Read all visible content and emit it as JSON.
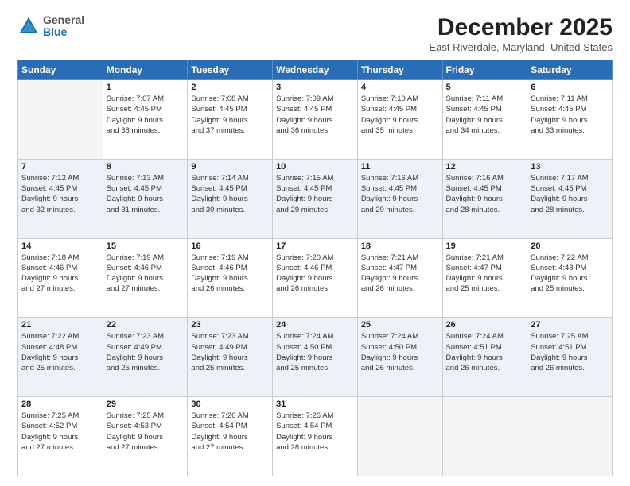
{
  "header": {
    "logo": {
      "line1": "General",
      "line2": "Blue"
    },
    "title": "December 2025",
    "location": "East Riverdale, Maryland, United States"
  },
  "columns": [
    "Sunday",
    "Monday",
    "Tuesday",
    "Wednesday",
    "Thursday",
    "Friday",
    "Saturday"
  ],
  "weeks": [
    [
      {
        "day": "",
        "info": ""
      },
      {
        "day": "1",
        "info": "Sunrise: 7:07 AM\nSunset: 4:45 PM\nDaylight: 9 hours\nand 38 minutes."
      },
      {
        "day": "2",
        "info": "Sunrise: 7:08 AM\nSunset: 4:45 PM\nDaylight: 9 hours\nand 37 minutes."
      },
      {
        "day": "3",
        "info": "Sunrise: 7:09 AM\nSunset: 4:45 PM\nDaylight: 9 hours\nand 36 minutes."
      },
      {
        "day": "4",
        "info": "Sunrise: 7:10 AM\nSunset: 4:45 PM\nDaylight: 9 hours\nand 35 minutes."
      },
      {
        "day": "5",
        "info": "Sunrise: 7:11 AM\nSunset: 4:45 PM\nDaylight: 9 hours\nand 34 minutes."
      },
      {
        "day": "6",
        "info": "Sunrise: 7:11 AM\nSunset: 4:45 PM\nDaylight: 9 hours\nand 33 minutes."
      }
    ],
    [
      {
        "day": "7",
        "info": "Sunrise: 7:12 AM\nSunset: 4:45 PM\nDaylight: 9 hours\nand 32 minutes."
      },
      {
        "day": "8",
        "info": "Sunrise: 7:13 AM\nSunset: 4:45 PM\nDaylight: 9 hours\nand 31 minutes."
      },
      {
        "day": "9",
        "info": "Sunrise: 7:14 AM\nSunset: 4:45 PM\nDaylight: 9 hours\nand 30 minutes."
      },
      {
        "day": "10",
        "info": "Sunrise: 7:15 AM\nSunset: 4:45 PM\nDaylight: 9 hours\nand 29 minutes."
      },
      {
        "day": "11",
        "info": "Sunrise: 7:16 AM\nSunset: 4:45 PM\nDaylight: 9 hours\nand 29 minutes."
      },
      {
        "day": "12",
        "info": "Sunrise: 7:16 AM\nSunset: 4:45 PM\nDaylight: 9 hours\nand 28 minutes."
      },
      {
        "day": "13",
        "info": "Sunrise: 7:17 AM\nSunset: 4:45 PM\nDaylight: 9 hours\nand 28 minutes."
      }
    ],
    [
      {
        "day": "14",
        "info": "Sunrise: 7:18 AM\nSunset: 4:46 PM\nDaylight: 9 hours\nand 27 minutes."
      },
      {
        "day": "15",
        "info": "Sunrise: 7:19 AM\nSunset: 4:46 PM\nDaylight: 9 hours\nand 27 minutes."
      },
      {
        "day": "16",
        "info": "Sunrise: 7:19 AM\nSunset: 4:46 PM\nDaylight: 9 hours\nand 26 minutes."
      },
      {
        "day": "17",
        "info": "Sunrise: 7:20 AM\nSunset: 4:46 PM\nDaylight: 9 hours\nand 26 minutes."
      },
      {
        "day": "18",
        "info": "Sunrise: 7:21 AM\nSunset: 4:47 PM\nDaylight: 9 hours\nand 26 minutes."
      },
      {
        "day": "19",
        "info": "Sunrise: 7:21 AM\nSunset: 4:47 PM\nDaylight: 9 hours\nand 25 minutes."
      },
      {
        "day": "20",
        "info": "Sunrise: 7:22 AM\nSunset: 4:48 PM\nDaylight: 9 hours\nand 25 minutes."
      }
    ],
    [
      {
        "day": "21",
        "info": "Sunrise: 7:22 AM\nSunset: 4:48 PM\nDaylight: 9 hours\nand 25 minutes."
      },
      {
        "day": "22",
        "info": "Sunrise: 7:23 AM\nSunset: 4:49 PM\nDaylight: 9 hours\nand 25 minutes."
      },
      {
        "day": "23",
        "info": "Sunrise: 7:23 AM\nSunset: 4:49 PM\nDaylight: 9 hours\nand 25 minutes."
      },
      {
        "day": "24",
        "info": "Sunrise: 7:24 AM\nSunset: 4:50 PM\nDaylight: 9 hours\nand 25 minutes."
      },
      {
        "day": "25",
        "info": "Sunrise: 7:24 AM\nSunset: 4:50 PM\nDaylight: 9 hours\nand 26 minutes."
      },
      {
        "day": "26",
        "info": "Sunrise: 7:24 AM\nSunset: 4:51 PM\nDaylight: 9 hours\nand 26 minutes."
      },
      {
        "day": "27",
        "info": "Sunrise: 7:25 AM\nSunset: 4:51 PM\nDaylight: 9 hours\nand 26 minutes."
      }
    ],
    [
      {
        "day": "28",
        "info": "Sunrise: 7:25 AM\nSunset: 4:52 PM\nDaylight: 9 hours\nand 27 minutes."
      },
      {
        "day": "29",
        "info": "Sunrise: 7:25 AM\nSunset: 4:53 PM\nDaylight: 9 hours\nand 27 minutes."
      },
      {
        "day": "30",
        "info": "Sunrise: 7:26 AM\nSunset: 4:54 PM\nDaylight: 9 hours\nand 27 minutes."
      },
      {
        "day": "31",
        "info": "Sunrise: 7:26 AM\nSunset: 4:54 PM\nDaylight: 9 hours\nand 28 minutes."
      },
      {
        "day": "",
        "info": ""
      },
      {
        "day": "",
        "info": ""
      },
      {
        "day": "",
        "info": ""
      }
    ]
  ]
}
